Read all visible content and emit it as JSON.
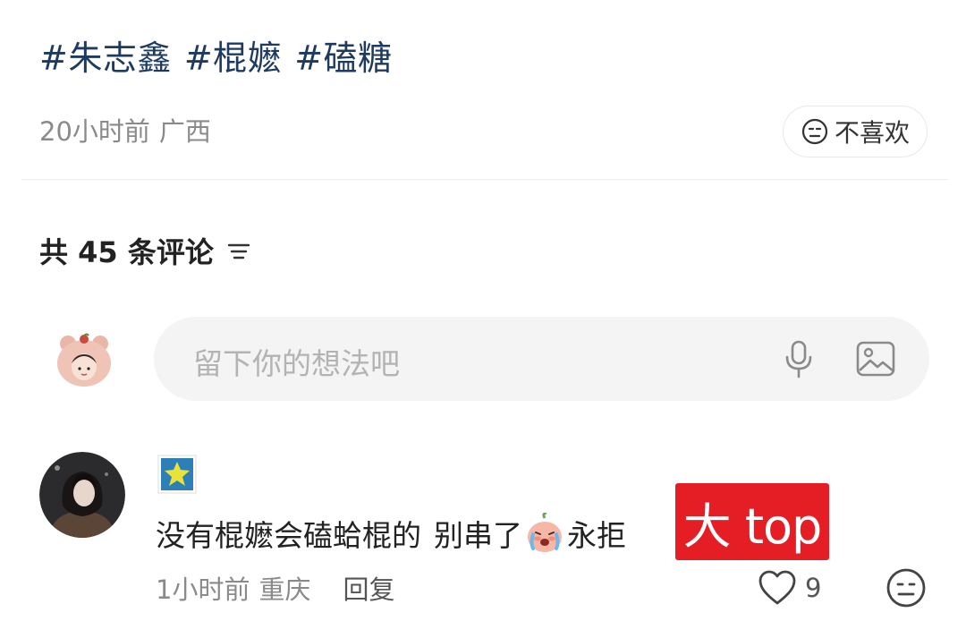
{
  "post": {
    "tags": [
      "#朱志鑫",
      "#棍嬷",
      "#磕糖"
    ],
    "time": "20小时前",
    "location": "广西",
    "dislike_label": "不喜欢"
  },
  "comments_header": {
    "label": "共 45 条评论"
  },
  "comment_input": {
    "placeholder": "留下你的想法吧"
  },
  "comment": {
    "text_part1": "没有棍嬷会磕蛤棍的",
    "text_part2": "别串了",
    "text_part3": "永拒",
    "sticker_text": "大 top",
    "time": "1小时前",
    "location": "重庆",
    "reply_label": "回复",
    "likes": "9"
  },
  "icons": {
    "dislike": "neutral-face-icon",
    "sort": "sort-lines-icon",
    "mic": "microphone-icon",
    "image": "image-icon",
    "like": "heart-icon",
    "badge": "star-badge-icon",
    "emoji": "crying-peach-emoji"
  },
  "colors": {
    "tag": "#1e3a5f",
    "muted": "#8a8a8a",
    "sticker_bg": "#e51d24",
    "input_bg": "#f4f4f4"
  }
}
